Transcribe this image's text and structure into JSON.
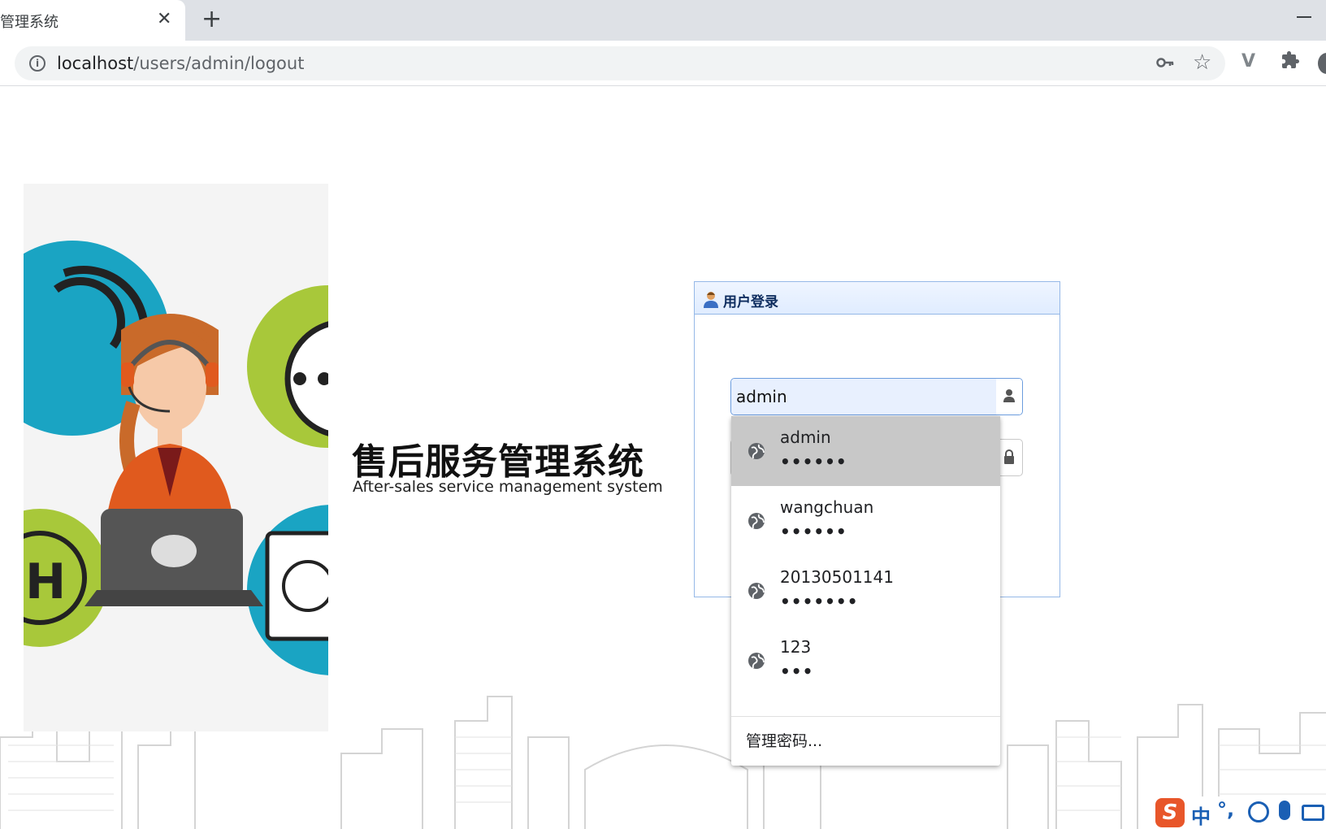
{
  "browser": {
    "tab_title": "管理系统",
    "tab_close": "✕",
    "new_tab": "+",
    "url_host": "localhost",
    "url_path": "/users/admin/logout",
    "info_icon": "i",
    "key_icon": "key-icon",
    "star_icon": "☆",
    "ext_icon": "V",
    "puzzle_icon": "puzzle-icon"
  },
  "brand": {
    "title": "售后服务管理系统",
    "subtitle": "After-sales service management system"
  },
  "login": {
    "header_title": "用户登录",
    "username_value": "admin",
    "password_value": ""
  },
  "autofill": {
    "suggestions": [
      {
        "username": "admin",
        "password_mask": "••••••"
      },
      {
        "username": "wangchuan",
        "password_mask": "••••••"
      },
      {
        "username": "20130501141",
        "password_mask": "•••••••"
      },
      {
        "username": "123",
        "password_mask": "•••"
      }
    ],
    "selected_index": 0,
    "manage_label": "管理密码..."
  },
  "ime": {
    "logo": "S",
    "mode": "中",
    "punct": "°,"
  },
  "colors": {
    "panel_border": "#95b8e7",
    "selected_suggestion": "#c8c8c8",
    "ime_blue": "#1a5fb4"
  }
}
